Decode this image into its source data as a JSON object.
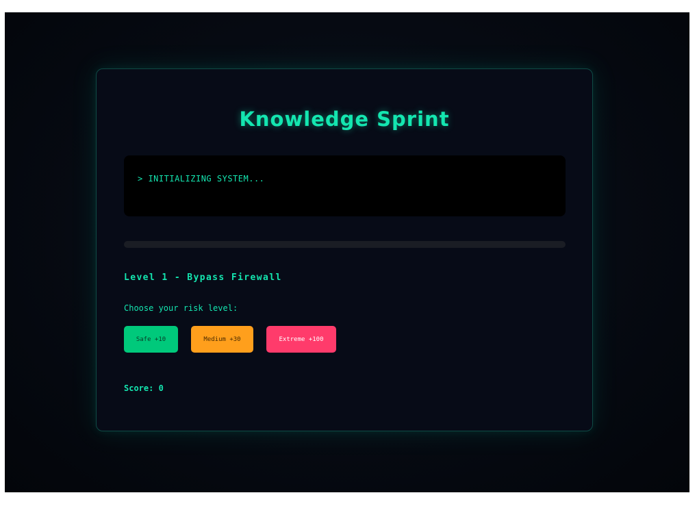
{
  "game": {
    "title": "Knowledge Sprint",
    "terminal_text": "> INITIALIZING SYSTEM...",
    "progress_percent": 0,
    "level_title": "Level 1 - Bypass Firewall",
    "risk_prompt": "Choose your risk level:",
    "risk_options": [
      {
        "label": "Safe +10",
        "color": "#00c97b"
      },
      {
        "label": "Medium +30",
        "color": "#ff9f1c"
      },
      {
        "label": "Extreme +100",
        "color": "#ff3b6b"
      }
    ],
    "score_text": "Score: 0"
  },
  "colors": {
    "accent": "#14e6b0",
    "panel_bg": "#070b17",
    "page_bg": "#03050a"
  }
}
